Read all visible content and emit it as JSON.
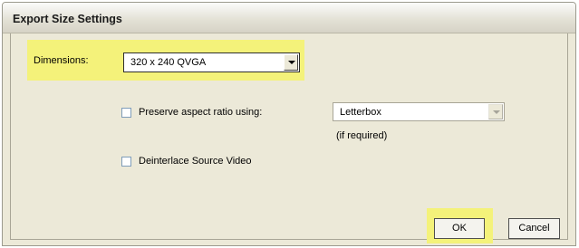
{
  "dialog": {
    "title": "Export Size Settings",
    "dimensions_label": "Dimensions:",
    "dimensions_value": "320 x 240 QVGA",
    "preserve_aspect_label": "Preserve aspect ratio using:",
    "preserve_aspect_checked": false,
    "aspect_method_value": "Letterbox",
    "aspect_note": "(if required)",
    "deinterlace_label": "Deinterlace Source Video",
    "deinterlace_checked": false,
    "ok_label": "OK",
    "cancel_label": "Cancel"
  },
  "colors": {
    "highlight": "#f4f27a",
    "window_bg": "#ece9d8"
  },
  "icons": {
    "dropdown": "chevron-down-icon",
    "checkbox": "checkbox-unchecked-icon"
  }
}
